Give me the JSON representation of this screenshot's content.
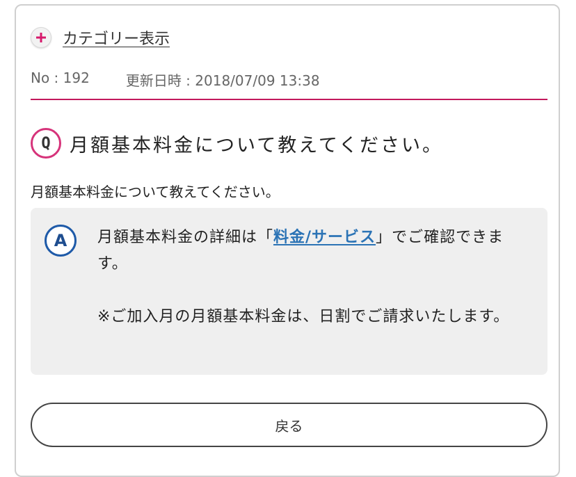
{
  "category": {
    "link_label": "カテゴリー表示",
    "icon": "plus-icon"
  },
  "meta": {
    "number": "No : 192",
    "updated": "更新日時 : 2018/07/09 13:38"
  },
  "question": {
    "badge": "Q",
    "title": "月額基本料金について教えてください。",
    "body": "月額基本料金について教えてください。"
  },
  "answer": {
    "badge": "A",
    "line1_prefix": "月額基本料金の詳細は「",
    "link_label": "料金/サービス",
    "line1_suffix": "」でご確認できます。",
    "note": "※ご加入月の月額基本料金は、日割でご請求いたします。"
  },
  "back_button": {
    "label": "戻る"
  },
  "colors": {
    "accent": "#c2185b",
    "q_badge": "#d6337a",
    "a_badge": "#1e5aa8",
    "link": "#2b73b5",
    "answer_bg": "#efefef"
  }
}
